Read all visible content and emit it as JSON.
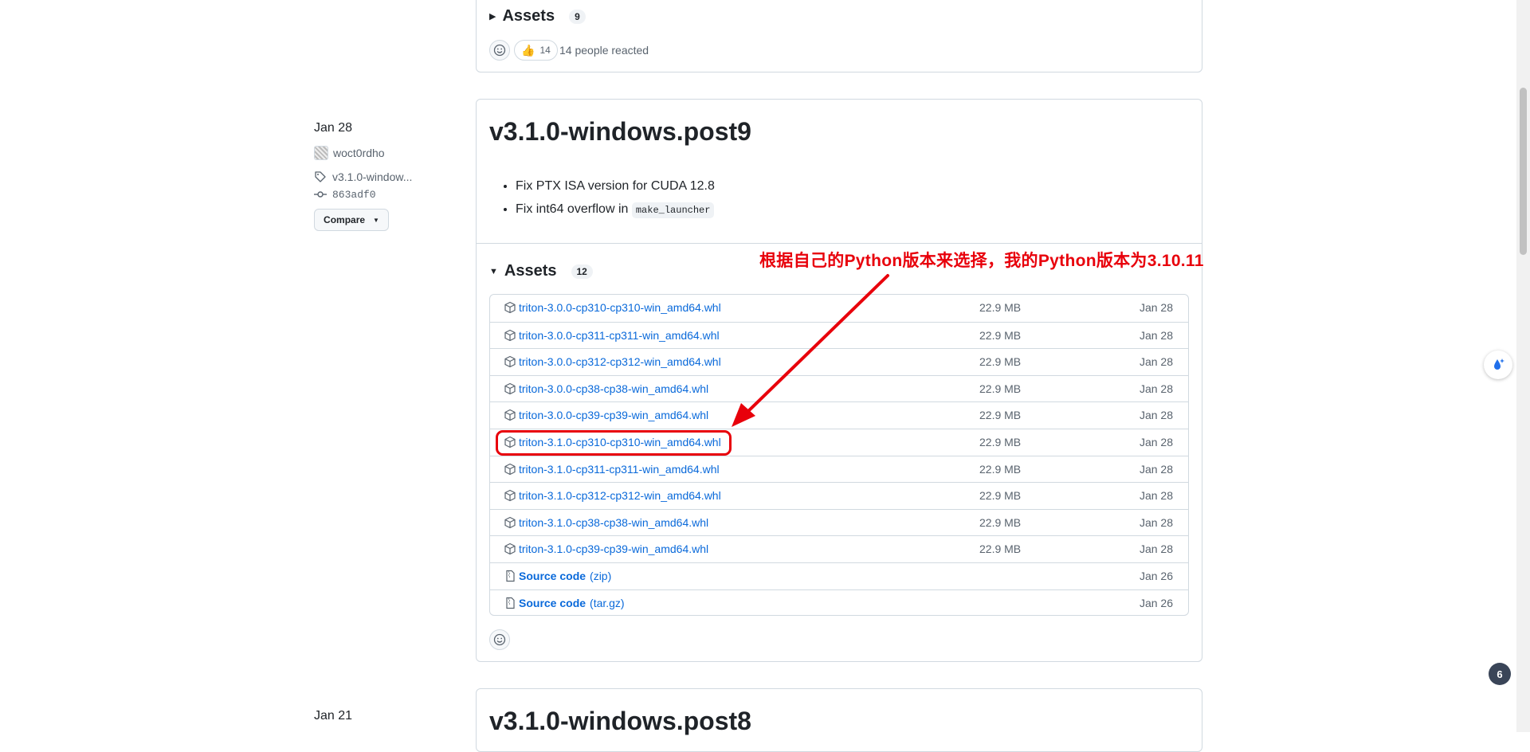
{
  "top_release": {
    "assets_label": "Assets",
    "assets_count": "9",
    "thumbs_count": "14",
    "reactions_text": "14 people reacted"
  },
  "release": {
    "date": "Jan 28",
    "author": "woct0rdho",
    "tag": "v3.1.0-window...",
    "commit": "863adf0",
    "compare_label": "Compare",
    "title": "v3.1.0-windows.post9",
    "notes": [
      "Fix PTX ISA version for CUDA 12.8",
      "Fix int64 overflow in "
    ],
    "note_code": "make_launcher",
    "assets_label": "Assets",
    "assets_count": "12",
    "assets": [
      {
        "name": "triton-3.0.0-cp310-cp310-win_amd64.whl",
        "size": "22.9 MB",
        "date": "Jan 28"
      },
      {
        "name": "triton-3.0.0-cp311-cp311-win_amd64.whl",
        "size": "22.9 MB",
        "date": "Jan 28"
      },
      {
        "name": "triton-3.0.0-cp312-cp312-win_amd64.whl",
        "size": "22.9 MB",
        "date": "Jan 28"
      },
      {
        "name": "triton-3.0.0-cp38-cp38-win_amd64.whl",
        "size": "22.9 MB",
        "date": "Jan 28"
      },
      {
        "name": "triton-3.0.0-cp39-cp39-win_amd64.whl",
        "size": "22.9 MB",
        "date": "Jan 28"
      },
      {
        "name": "triton-3.1.0-cp310-cp310-win_amd64.whl",
        "size": "22.9 MB",
        "date": "Jan 28"
      },
      {
        "name": "triton-3.1.0-cp311-cp311-win_amd64.whl",
        "size": "22.9 MB",
        "date": "Jan 28"
      },
      {
        "name": "triton-3.1.0-cp312-cp312-win_amd64.whl",
        "size": "22.9 MB",
        "date": "Jan 28"
      },
      {
        "name": "triton-3.1.0-cp38-cp38-win_amd64.whl",
        "size": "22.9 MB",
        "date": "Jan 28"
      },
      {
        "name": "triton-3.1.0-cp39-cp39-win_amd64.whl",
        "size": "22.9 MB",
        "date": "Jan 28"
      }
    ],
    "source_zip": {
      "name": "Source code",
      "suffix": "(zip)",
      "date": "Jan 26"
    },
    "source_tar": {
      "name": "Source code",
      "suffix": "(tar.gz)",
      "date": "Jan 26"
    }
  },
  "annotation": {
    "text": "根据自己的Python版本来选择，我的Python版本为3.10.11",
    "color": "#e8000b"
  },
  "next_release": {
    "date": "Jan 21",
    "title": "v3.1.0-windows.post8"
  },
  "floating": {
    "badge_count": "6"
  }
}
